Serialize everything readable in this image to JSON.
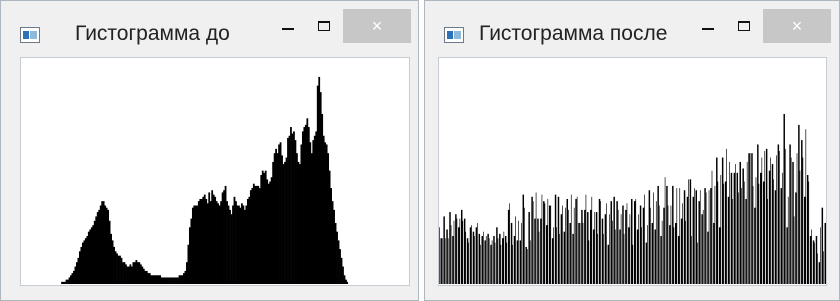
{
  "windows": [
    {
      "title": "Гистограмма до",
      "icon": "app-icon",
      "controls": {
        "minimize": "minimize-icon",
        "maximize": "maximize-icon",
        "close": "×"
      }
    },
    {
      "title": "Гистограмма после",
      "icon": "app-icon",
      "controls": {
        "minimize": "minimize-icon",
        "maximize": "maximize-icon",
        "close": "×"
      }
    }
  ],
  "colors": {
    "bar": "#000000",
    "close_button": "#c7c7c7",
    "window_frame": "#f0f0f0",
    "canvas": "#ffffff"
  },
  "chart_data": [
    {
      "type": "bar",
      "title": "",
      "xlabel": "",
      "ylabel": "",
      "xlim": [
        0,
        255
      ],
      "ylim": [
        0,
        100
      ],
      "grid": false,
      "legend": "none",
      "values": [
        0,
        0,
        0,
        0,
        0,
        0,
        0,
        0,
        0,
        0,
        0,
        0,
        0,
        0,
        0,
        0,
        0,
        0,
        0,
        0,
        0,
        0,
        0,
        0,
        0,
        0,
        0,
        1,
        1,
        1,
        2,
        2,
        3,
        4,
        5,
        6,
        8,
        10,
        12,
        15,
        17,
        19,
        20,
        21,
        22,
        24,
        25,
        26,
        27,
        29,
        31,
        33,
        34,
        36,
        38,
        38,
        36,
        35,
        34,
        29,
        23,
        20,
        17,
        15,
        14,
        13,
        13,
        12,
        10,
        10,
        9,
        8,
        8,
        9,
        8,
        10,
        10,
        11,
        10,
        10,
        9,
        8,
        7,
        6,
        6,
        5,
        5,
        4,
        4,
        4,
        4,
        4,
        4,
        4,
        3,
        3,
        3,
        3,
        3,
        3,
        3,
        3,
        3,
        3,
        3,
        3,
        4,
        4,
        4,
        5,
        6,
        10,
        18,
        26,
        30,
        35,
        36,
        36,
        36,
        38,
        39,
        39,
        40,
        41,
        39,
        37,
        42,
        38,
        43,
        41,
        40,
        38,
        37,
        36,
        38,
        42,
        43,
        45,
        38,
        36,
        34,
        32,
        36,
        40,
        38,
        36,
        36,
        35,
        37,
        36,
        34,
        36,
        39,
        40,
        43,
        44,
        46,
        45,
        45,
        45,
        44,
        50,
        52,
        51,
        52,
        48,
        46,
        47,
        49,
        56,
        60,
        62,
        60,
        64,
        65,
        59,
        55,
        56,
        58,
        67,
        68,
        72,
        69,
        70,
        66,
        60,
        56,
        55,
        64,
        70,
        72,
        73,
        76,
        72,
        65,
        60,
        66,
        68,
        70,
        91,
        95,
        88,
        78,
        68,
        65,
        64,
        60,
        52,
        44,
        38,
        34,
        28,
        24,
        20,
        16,
        12,
        8,
        4,
        2,
        1,
        0,
        0,
        0,
        0,
        0,
        0,
        0,
        0,
        0,
        0,
        0,
        0,
        0,
        0,
        0,
        0,
        0,
        0,
        0,
        0,
        0,
        0,
        0,
        0,
        0,
        0,
        0,
        0,
        0,
        0,
        0,
        0,
        0,
        0,
        0,
        0,
        0,
        0,
        0,
        0,
        0
      ]
    },
    {
      "type": "bar",
      "title": "",
      "xlabel": "",
      "ylabel": "",
      "xlim": [
        0,
        255
      ],
      "ylim": [
        0,
        100
      ],
      "grid": false,
      "legend": "none",
      "values": [
        26,
        21,
        21,
        31,
        21,
        25,
        21,
        33,
        27,
        22,
        29,
        32,
        30,
        26,
        30,
        34,
        29,
        30,
        24,
        21,
        19,
        26,
        27,
        24,
        22,
        26,
        28,
        23,
        18,
        22,
        24,
        20,
        22,
        23,
        21,
        18,
        20,
        22,
        19,
        26,
        21,
        23,
        18,
        21,
        24,
        22,
        19,
        34,
        37,
        28,
        18,
        22,
        31,
        20,
        29,
        20,
        28,
        41,
        35,
        17,
        16,
        33,
        20,
        40,
        38,
        30,
        42,
        30,
        24,
        30,
        41,
        38,
        37,
        27,
        39,
        36,
        36,
        21,
        26,
        41,
        26,
        40,
        23,
        32,
        36,
        24,
        35,
        39,
        34,
        28,
        41,
        23,
        35,
        39,
        40,
        28,
        28,
        34,
        28,
        34,
        41,
        33,
        20,
        34,
        40,
        25,
        33,
        33,
        23,
        39,
        38,
        30,
        23,
        32,
        37,
        18,
        32,
        38,
        29,
        40,
        25,
        38,
        34,
        25,
        32,
        36,
        23,
        34,
        37,
        26,
        32,
        39,
        18,
        38,
        39,
        25,
        32,
        36,
        26,
        35,
        41,
        19,
        27,
        43,
        35,
        28,
        42,
        25,
        38,
        45,
        36,
        22,
        29,
        35,
        49,
        45,
        36,
        27,
        36,
        45,
        26,
        28,
        44,
        22,
        44,
        30,
        37,
        43,
        29,
        40,
        48,
        48,
        22,
        40,
        44,
        43,
        19,
        38,
        43,
        32,
        34,
        44,
        42,
        24,
        43,
        44,
        52,
        28,
        45,
        58,
        47,
        26,
        50,
        58,
        46,
        47,
        62,
        40,
        56,
        51,
        39,
        51,
        55,
        51,
        42,
        56,
        44,
        53,
        47,
        39,
        56,
        60,
        60,
        60,
        45,
        35,
        49,
        64,
        46,
        51,
        58,
        47,
        61,
        62,
        39,
        52,
        58,
        55,
        48,
        43,
        59,
        64,
        61,
        44,
        51,
        78,
        62,
        26,
        40,
        64,
        58,
        56,
        31,
        42,
        60,
        73,
        52,
        66,
        58,
        40,
        71,
        50,
        47,
        22,
        25,
        20,
        19,
        22,
        14,
        10,
        26,
        35,
        15,
        28
      ]
    }
  ]
}
